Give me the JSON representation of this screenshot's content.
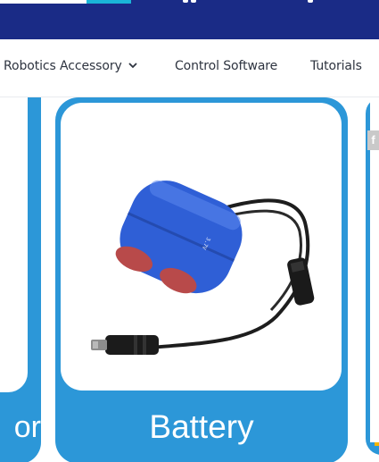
{
  "nav": {
    "items": [
      {
        "label": "Robotics Accessory",
        "has_dropdown": true
      },
      {
        "label": "Control Software"
      },
      {
        "label": "Tutorials"
      }
    ]
  },
  "products": {
    "left_partial_label": "or",
    "main_label": "Battery",
    "share_icon_glyph": "f"
  },
  "colors": {
    "header_bg": "#1a2b86",
    "accent_cyan": "#1ab6d8",
    "card_blue": "#2c97d8",
    "battery_blue": "#2f5fd6",
    "battery_red": "#b84a4a"
  },
  "icons": {
    "dropdown": "chevron-down-icon",
    "share": "facebook-share-icon"
  }
}
